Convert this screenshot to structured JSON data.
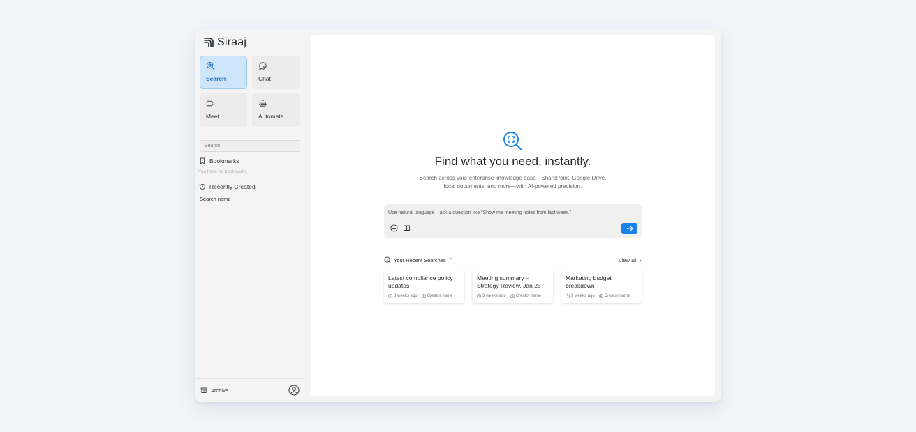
{
  "app": {
    "name": "Siraaj"
  },
  "sidebar": {
    "modes": [
      {
        "label": "Search",
        "icon": "search-icon",
        "active": true
      },
      {
        "label": "Chat",
        "icon": "chat-icon",
        "active": false
      },
      {
        "label": "Meet",
        "icon": "video-icon",
        "active": false
      },
      {
        "label": "Automate",
        "icon": "robot-icon",
        "active": false
      }
    ],
    "search_placeholder": "Search",
    "bookmarks_label": "Bookmarks",
    "bookmarks_empty": "You have no bookmarks",
    "recent_label": "Recently Created",
    "recent_items": [
      "Search name"
    ],
    "archive_label": "Archive"
  },
  "main": {
    "title": "Find what you need, instantly.",
    "subtitle": "Search across your enterprise knowledge base—SharePoint, Google Drive, local documents, and more—with AI-powered precision.",
    "query_placeholder": "Use natural language—ask a question like \"Show me meeting notes from last week.\"",
    "recent_title": "Your Recent Searches",
    "view_all": "View all",
    "cards": [
      {
        "title": "Latest compliance policy updates",
        "time": "3 weeks ago",
        "creator": "Creator name"
      },
      {
        "title": "Meeting summary – Strategy Review, Jan 25",
        "time": "3 weeks ago",
        "creator": "Creator name"
      },
      {
        "title": "Marketing budget breakdown",
        "time": "3 weeks ago",
        "creator": "Creator name"
      }
    ]
  },
  "colors": {
    "accent": "#1682ea",
    "active_tile": "#cfe6fa",
    "page_bg": "#f2f6fb"
  }
}
